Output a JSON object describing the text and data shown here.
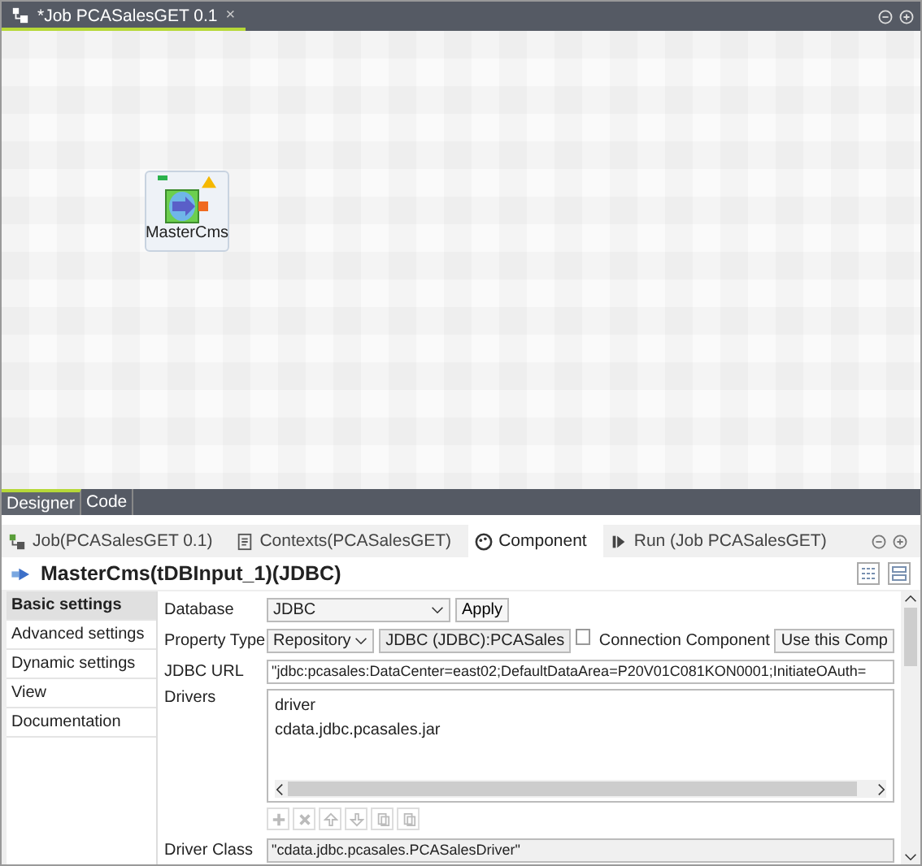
{
  "editor": {
    "tabs": [
      {
        "label": "*Job PCASalesGET 0.1",
        "selected": true,
        "close": "×"
      }
    ]
  },
  "canvas": {
    "nodes": [
      {
        "label": "MasterCms",
        "warning": true
      }
    ]
  },
  "view_tabs": [
    {
      "label": "Designer",
      "selected": true
    },
    {
      "label": "Code",
      "selected": false
    }
  ],
  "panel_tabs": [
    {
      "label": "Job(PCASalesGET 0.1)",
      "selected": false
    },
    {
      "label": "Contexts(PCASalesGET)",
      "selected": false
    },
    {
      "label": "Component",
      "selected": true
    },
    {
      "label": "Run (Job PCASalesGET)",
      "selected": false
    }
  ],
  "component_title": "MasterCms(tDBInput_1)(JDBC)",
  "sidebar": {
    "items": [
      {
        "label": "Basic settings",
        "selected": true
      },
      {
        "label": "Advanced settings",
        "selected": false
      },
      {
        "label": "Dynamic settings",
        "selected": false
      },
      {
        "label": "View",
        "selected": false
      },
      {
        "label": "Documentation",
        "selected": false
      }
    ]
  },
  "form": {
    "database": {
      "label": "Database",
      "value": "JDBC",
      "button": "Apply"
    },
    "property_type": {
      "label": "Property Type",
      "value": "Repository",
      "repository": "JDBC (JDBC):PCASales",
      "connection_checked": false,
      "connection_label": "Connection Component",
      "connection_value": "Use this Comp"
    },
    "jdbc_url": {
      "label": "JDBC URL",
      "value": "\"jdbc:pcasales:DataCenter=east02;DefaultDataArea=P20V01C081KON0001;InitiateOAuth="
    },
    "drivers": {
      "label": "Drivers",
      "rows": [
        "driver",
        "cdata.jdbc.pcasales.jar"
      ]
    },
    "driver_class": {
      "label": "Driver Class",
      "value": "\"cdata.jdbc.pcasales.PCASalesDriver\""
    }
  }
}
